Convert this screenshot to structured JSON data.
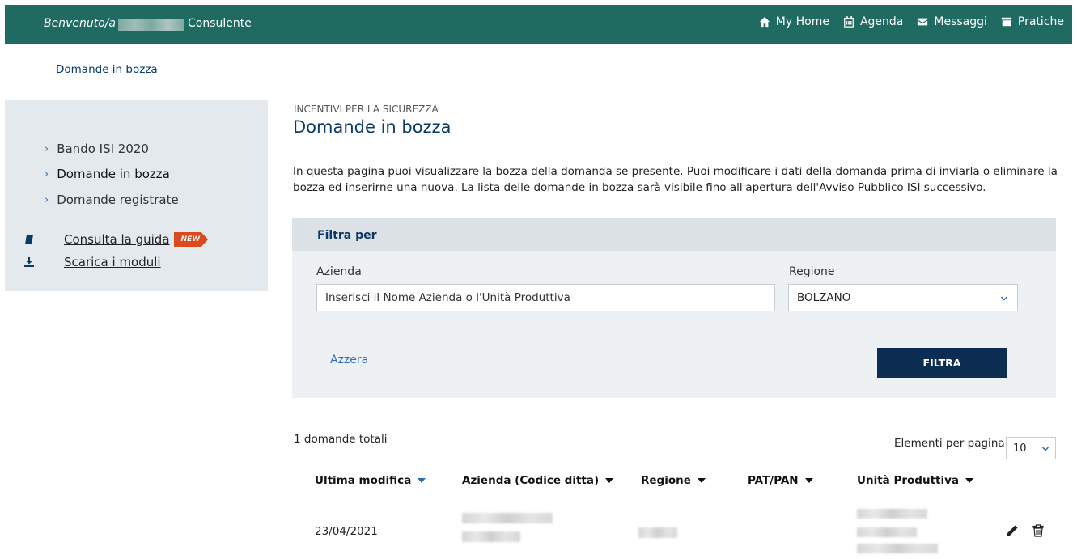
{
  "header": {
    "welcome": "Benvenuto/a",
    "role": "Consulente",
    "nav": [
      {
        "label": "My Home",
        "icon": "home-icon"
      },
      {
        "label": "Agenda",
        "icon": "calendar-icon"
      },
      {
        "label": "Messaggi",
        "icon": "envelope-icon"
      },
      {
        "label": "Pratiche",
        "icon": "folder-icon"
      }
    ]
  },
  "breadcrumb": "Domande in bozza",
  "sidebar": {
    "items": [
      {
        "label": "Bando ISI 2020"
      },
      {
        "label": "Domande in bozza"
      },
      {
        "label": "Domande registrate"
      }
    ],
    "tools": [
      {
        "label": "Consulta la guida",
        "icon": "book-icon",
        "badge": "NEW"
      },
      {
        "label": "Scarica i moduli",
        "icon": "download-icon"
      }
    ]
  },
  "main": {
    "kicker": "INCENTIVI PER LA SICUREZZA",
    "title": "Domande in bozza",
    "intro": "In questa pagina puoi visualizzare la bozza della domanda se presente. Puoi modificare i dati della domanda prima di inviarla o eliminare la bozza ed inserirne una nuova. La lista delle domande in bozza sarà visibile fino all'apertura dell'Avviso Pubblico ISI successivo."
  },
  "filter": {
    "heading": "Filtra per",
    "azienda_label": "Azienda",
    "azienda_placeholder": "Inserisci il Nome Azienda o l'Unità Produttiva",
    "regione_label": "Regione",
    "regione_value": "BOLZANO",
    "reset_label": "Azzera",
    "submit_label": "FILTRA"
  },
  "results": {
    "total": "1 domande totali",
    "per_page_label": "Elementi per pagina",
    "per_page_value": "10",
    "columns": [
      "Ultima modifica",
      "Azienda (Codice ditta)",
      "Regione",
      "PAT/PAN",
      "Unità Produttiva"
    ],
    "rows": [
      {
        "ultima_modifica": "23/04/2021"
      }
    ]
  },
  "colors": {
    "header_bg": "#1f6b62",
    "primary_dark": "#0b2d52",
    "link_blue": "#2d6db5",
    "badge_orange": "#d94a1e"
  }
}
